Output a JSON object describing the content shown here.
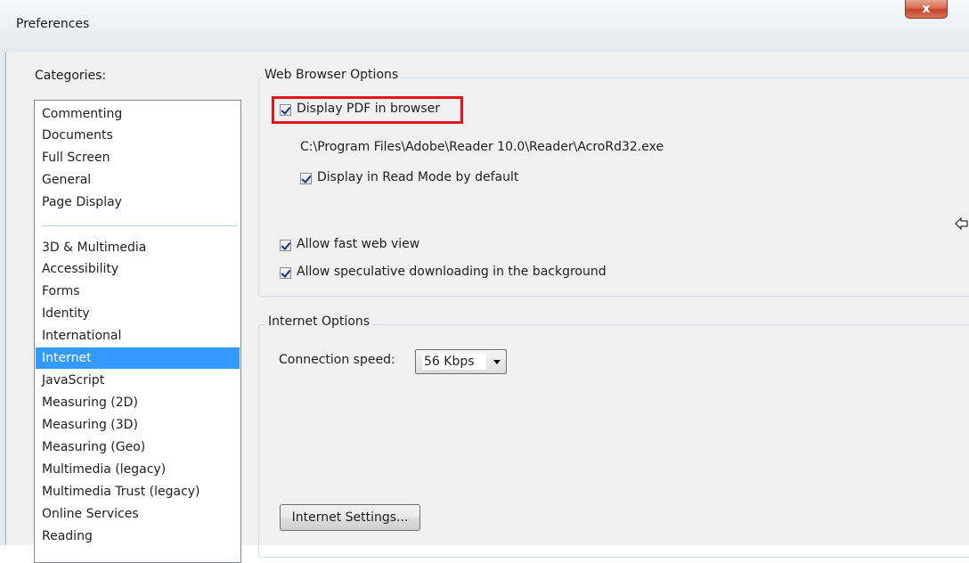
{
  "window": {
    "title": "Preferences",
    "close_label": "x"
  },
  "categories": {
    "label": "Categories:",
    "group1": [
      "Commenting",
      "Documents",
      "Full Screen",
      "General",
      "Page Display"
    ],
    "group2": [
      "3D & Multimedia",
      "Accessibility",
      "Forms",
      "Identity",
      "International",
      "Internet",
      "JavaScript",
      "Measuring (2D)",
      "Measuring (3D)",
      "Measuring (Geo)",
      "Multimedia (legacy)",
      "Multimedia Trust (legacy)",
      "Online Services",
      "Reading"
    ],
    "selected": "Internet"
  },
  "web_browser_options": {
    "title": "Web Browser Options",
    "display_pdf_label": "Display PDF in browser",
    "display_pdf_checked": true,
    "reader_path": "C:\\Program Files\\Adobe\\Reader 10.0\\Reader\\AcroRd32.exe",
    "read_mode_label": "Display in Read Mode by default",
    "read_mode_checked": true,
    "fast_web_view_label": "Allow fast web view",
    "fast_web_view_checked": true,
    "speculative_label": "Allow speculative downloading in the background",
    "speculative_checked": true
  },
  "internet_options": {
    "title": "Internet Options",
    "connection_speed_label": "Connection speed:",
    "connection_speed_value": "56 Kbps",
    "settings_button": "Internet Settings..."
  },
  "colors": {
    "selection": "#3399ff",
    "highlight": "#e3151c"
  }
}
